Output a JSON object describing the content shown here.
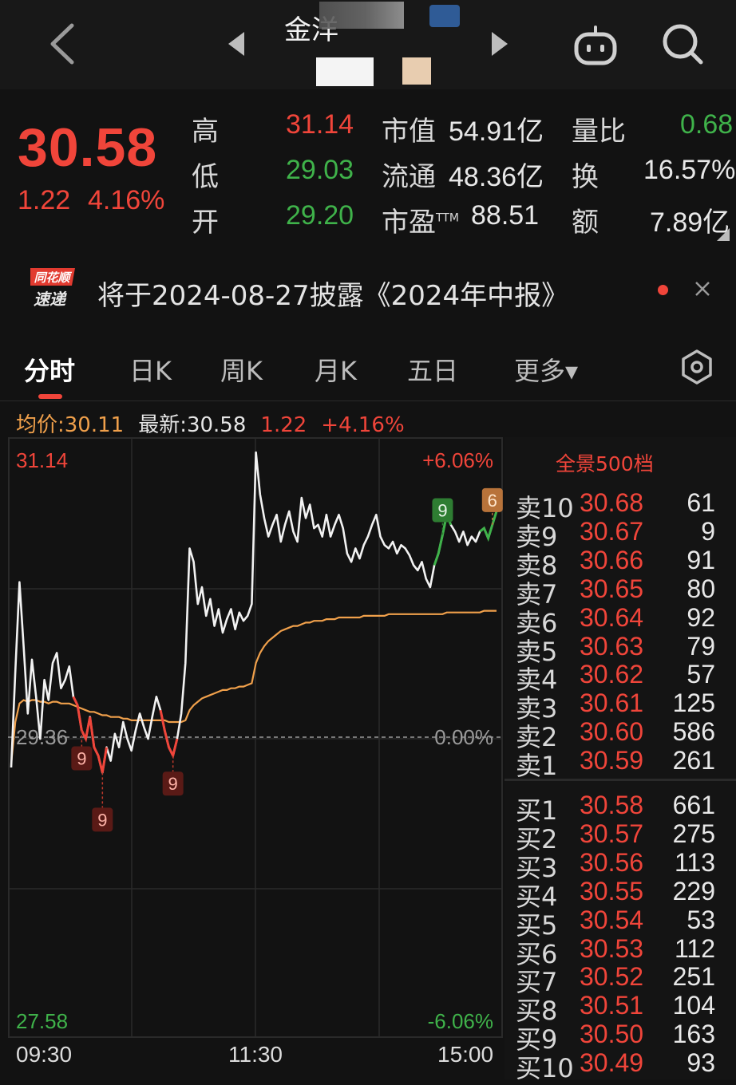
{
  "header": {
    "title": "金洋",
    "back_icon": "chevron-left-icon",
    "prev_icon": "triangle-left-icon",
    "next_icon": "triangle-right-icon",
    "robot_icon": "robot-icon",
    "search_icon": "search-icon"
  },
  "quote": {
    "price": "30.58",
    "change": "1.22",
    "change_pct": "4.16%",
    "rows": [
      {
        "label": "高",
        "value": "31.14",
        "color": "red",
        "label2": "市值",
        "value2": "54.91亿",
        "label3": "量比",
        "value3": "0.68",
        "color3": "green"
      },
      {
        "label": "低",
        "value": "29.03",
        "color": "green",
        "label2": "流通",
        "value2": "48.36亿",
        "label3": "换",
        "value3": "16.57%",
        "color3": "white"
      },
      {
        "label": "开",
        "value": "29.20",
        "color": "green",
        "label2": "市盈",
        "label2_sup": "TTM",
        "value2": "88.51",
        "label3": "额",
        "value3": "7.89亿",
        "color3": "white"
      }
    ]
  },
  "notice": {
    "logo_line1": "同花顺",
    "logo_line2": "速递",
    "text": "将于2024-08-27披露《2024年中报》"
  },
  "tabs": [
    {
      "label": "分时",
      "active": true
    },
    {
      "label": "日K"
    },
    {
      "label": "周K"
    },
    {
      "label": "月K"
    },
    {
      "label": "五日"
    },
    {
      "label": "更多▾"
    }
  ],
  "info": {
    "avg": "均价:30.11",
    "latest": "最新:30.58",
    "change": "1.22",
    "pct": "+4.16%"
  },
  "chart_data": {
    "type": "line",
    "y_top_label": "31.14",
    "y_bottom_label": "27.58",
    "y_pct_top": "+6.06%",
    "y_pct_bottom": "-6.06%",
    "prev_close_label": "29.36",
    "mid_pct_label": "0.00%",
    "x_labels": [
      "09:30",
      "11:30",
      "15:00"
    ],
    "ylim": [
      27.58,
      31.14
    ],
    "prev_close": 29.36,
    "markers": [
      {
        "label": "9",
        "color": "red",
        "index": 17
      },
      {
        "label": "9",
        "color": "red",
        "index": 22
      },
      {
        "label": "9",
        "color": "red",
        "index": 39
      },
      {
        "label": "9",
        "color": "green",
        "index": 104
      },
      {
        "label": "6",
        "color": "orange",
        "index": 116
      }
    ],
    "series": [
      {
        "name": "最新",
        "values": [
          29.18,
          29.75,
          30.28,
          29.9,
          29.5,
          29.82,
          29.6,
          29.35,
          29.7,
          29.58,
          29.8,
          29.86,
          29.65,
          29.7,
          29.78,
          29.6,
          29.55,
          29.4,
          29.35,
          29.48,
          29.3,
          29.25,
          29.15,
          29.3,
          29.22,
          29.38,
          29.3,
          29.45,
          29.35,
          29.28,
          29.4,
          29.5,
          29.42,
          29.35,
          29.48,
          29.6,
          29.52,
          29.4,
          29.3,
          29.25,
          29.35,
          29.5,
          29.8,
          30.48,
          30.4,
          30.15,
          30.25,
          30.08,
          30.18,
          30.02,
          30.12,
          29.98,
          30.06,
          30.12,
          30.0,
          30.1,
          30.05,
          30.08,
          30.15,
          31.05,
          30.8,
          30.66,
          30.55,
          30.62,
          30.68,
          30.52,
          30.62,
          30.7,
          30.58,
          30.52,
          30.78,
          30.66,
          30.74,
          30.6,
          30.62,
          30.55,
          30.68,
          30.55,
          30.62,
          30.68,
          30.6,
          30.45,
          30.4,
          30.48,
          30.42,
          30.5,
          30.55,
          30.62,
          30.68,
          30.55,
          30.5,
          30.48,
          30.52,
          30.45,
          30.5,
          30.48,
          30.44,
          30.38,
          30.35,
          30.4,
          30.3,
          30.25,
          30.38,
          30.45,
          30.56,
          30.68,
          30.62,
          30.58,
          30.52,
          30.58,
          30.5,
          30.55,
          30.52,
          30.58,
          30.6,
          30.54,
          30.62,
          30.7
        ]
      },
      {
        "name": "均价",
        "values": [
          29.2,
          29.45,
          29.56,
          29.58,
          29.57,
          29.58,
          29.58,
          29.57,
          29.57,
          29.56,
          29.57,
          29.57,
          29.56,
          29.56,
          29.56,
          29.55,
          29.54,
          29.53,
          29.52,
          29.51,
          29.51,
          29.5,
          29.49,
          29.49,
          29.48,
          29.48,
          29.48,
          29.47,
          29.47,
          29.46,
          29.46,
          29.46,
          29.46,
          29.46,
          29.46,
          29.46,
          29.46,
          29.46,
          29.45,
          29.45,
          29.45,
          29.45,
          29.46,
          29.52,
          29.55,
          29.57,
          29.59,
          29.6,
          29.61,
          29.62,
          29.63,
          29.64,
          29.64,
          29.65,
          29.65,
          29.66,
          29.66,
          29.67,
          29.68,
          29.8,
          29.86,
          29.9,
          29.93,
          29.95,
          29.97,
          29.99,
          30.0,
          30.01,
          30.02,
          30.02,
          30.03,
          30.04,
          30.04,
          30.05,
          30.05,
          30.05,
          30.06,
          30.06,
          30.06,
          30.07,
          30.07,
          30.07,
          30.07,
          30.07,
          30.07,
          30.08,
          30.08,
          30.08,
          30.08,
          30.08,
          30.08,
          30.09,
          30.09,
          30.09,
          30.09,
          30.09,
          30.09,
          30.09,
          30.09,
          30.09,
          30.09,
          30.09,
          30.09,
          30.09,
          30.09,
          30.1,
          30.1,
          30.1,
          30.1,
          30.1,
          30.1,
          30.1,
          30.1,
          30.1,
          30.11,
          30.11,
          30.11,
          30.11
        ]
      }
    ]
  },
  "orderbook": {
    "title": "全景500档",
    "sell": [
      {
        "label": "卖10",
        "price": "30.68",
        "vol": "61"
      },
      {
        "label": "卖9",
        "price": "30.67",
        "vol": "9"
      },
      {
        "label": "卖8",
        "price": "30.66",
        "vol": "91"
      },
      {
        "label": "卖7",
        "price": "30.65",
        "vol": "80"
      },
      {
        "label": "卖6",
        "price": "30.64",
        "vol": "92"
      },
      {
        "label": "卖5",
        "price": "30.63",
        "vol": "79"
      },
      {
        "label": "卖4",
        "price": "30.62",
        "vol": "57"
      },
      {
        "label": "卖3",
        "price": "30.61",
        "vol": "125"
      },
      {
        "label": "卖2",
        "price": "30.60",
        "vol": "586"
      },
      {
        "label": "卖1",
        "price": "30.59",
        "vol": "261"
      }
    ],
    "buy": [
      {
        "label": "买1",
        "price": "30.58",
        "vol": "661"
      },
      {
        "label": "买2",
        "price": "30.57",
        "vol": "275"
      },
      {
        "label": "买3",
        "price": "30.56",
        "vol": "113"
      },
      {
        "label": "买4",
        "price": "30.55",
        "vol": "229"
      },
      {
        "label": "买5",
        "price": "30.54",
        "vol": "53"
      },
      {
        "label": "买6",
        "price": "30.53",
        "vol": "112"
      },
      {
        "label": "买7",
        "price": "30.52",
        "vol": "251"
      },
      {
        "label": "买8",
        "price": "30.51",
        "vol": "104"
      },
      {
        "label": "买9",
        "price": "30.50",
        "vol": "163"
      },
      {
        "label": "买10",
        "price": "30.49",
        "vol": "93"
      }
    ]
  },
  "colors": {
    "up": "#f0453a",
    "down": "#3fb24a",
    "avg_line": "#f0a04b",
    "price_line": "#f2f2f2",
    "background": "#121212"
  }
}
